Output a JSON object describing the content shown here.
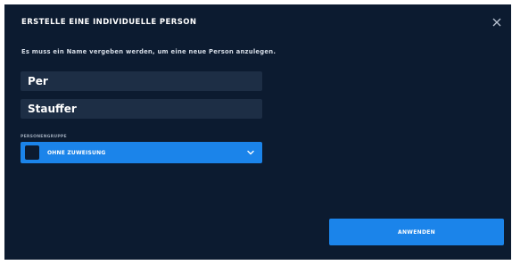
{
  "dialog": {
    "title": "ERSTELLE EINE INDIVIDUELLE PERSON",
    "subtitle": "Es muss ein Name vergeben werden, um eine neue Person anzulegen.",
    "close_icon": "close-icon"
  },
  "form": {
    "first_name": "Per",
    "last_name": "Stauffer",
    "group_label": "PERSONENGRUPPE",
    "group_value": "OHNE ZUWEISUNG",
    "group_icon": "chevron-down-icon"
  },
  "actions": {
    "apply_label": "ANWENDEN"
  },
  "colors": {
    "background": "#0c1b30",
    "field_background": "#1d2e45",
    "accent": "#1b84ea"
  }
}
